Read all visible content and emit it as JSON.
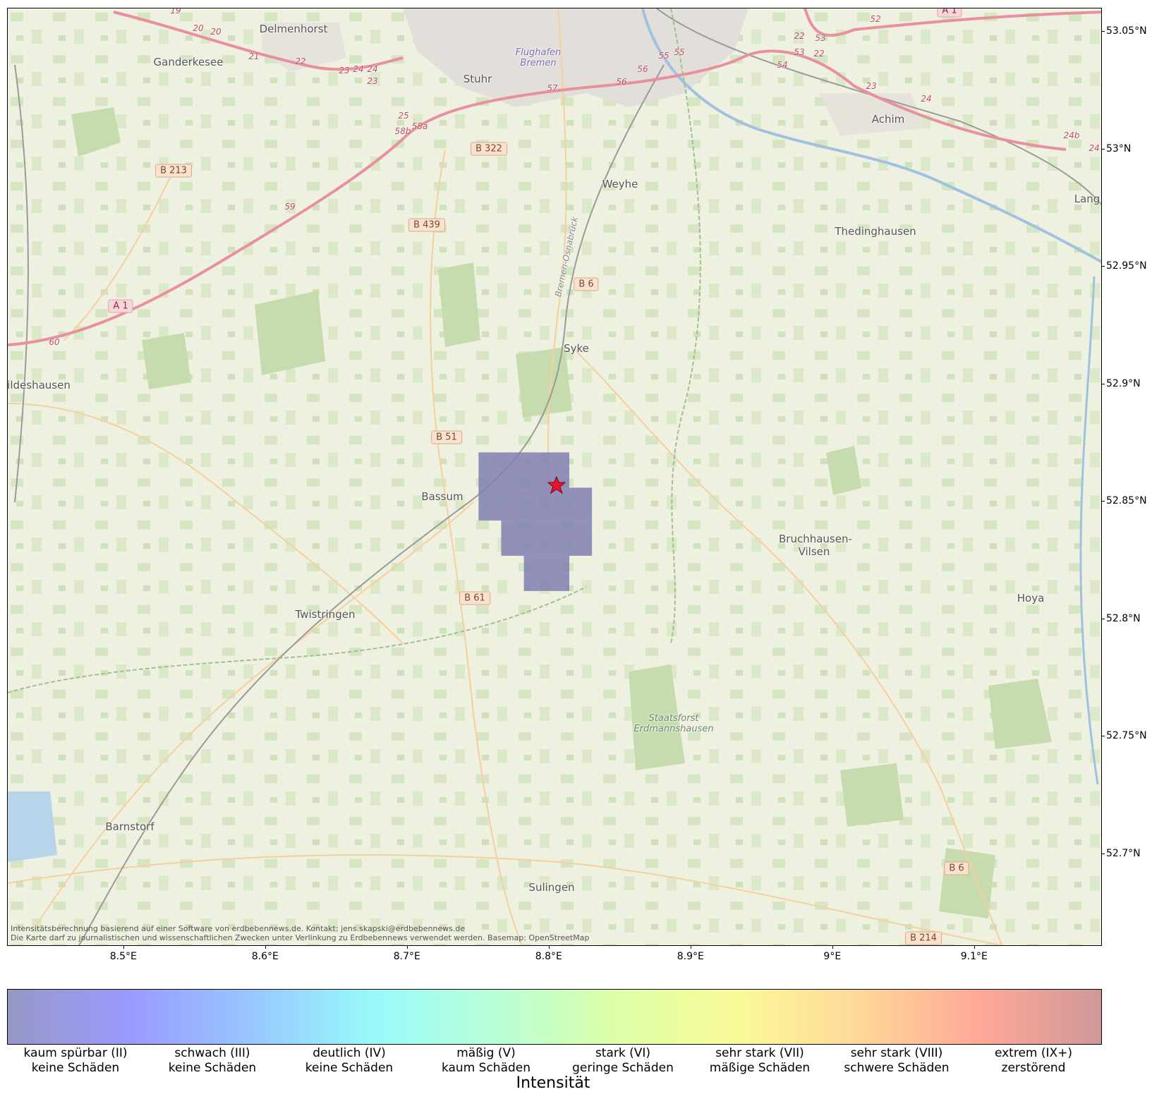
{
  "map": {
    "places": [
      {
        "name": "Delmenhorst",
        "style": "town"
      },
      {
        "name": "Ganderkesee",
        "style": "town"
      },
      {
        "name": "Stuhr",
        "style": "town"
      },
      {
        "name": "Flughafen Bremen",
        "style": "airport"
      },
      {
        "name": "Achim",
        "style": "town"
      },
      {
        "name": "Weyhe",
        "style": "town"
      },
      {
        "name": "Thedinghausen",
        "style": "town"
      },
      {
        "name": "Syke",
        "style": "town"
      },
      {
        "name": "ildeshausen",
        "style": "town"
      },
      {
        "name": "Bassum",
        "style": "town"
      },
      {
        "name": "Bruchhausen-Vilsen",
        "style": "town"
      },
      {
        "name": "Hoya",
        "style": "town"
      },
      {
        "name": "Twistringen",
        "style": "town"
      },
      {
        "name": "Staatsforst Erdmannshausen",
        "style": "forest"
      },
      {
        "name": "Barnstorf",
        "style": "town"
      },
      {
        "name": "Sulingen",
        "style": "town"
      },
      {
        "name": "Lang",
        "style": "town"
      }
    ],
    "road_shields": [
      {
        "label": "B 322",
        "type": "primary"
      },
      {
        "label": "B 213",
        "type": "primary"
      },
      {
        "label": "B 439",
        "type": "primary"
      },
      {
        "label": "B 6",
        "type": "primary"
      },
      {
        "label": "A 1",
        "type": "motorway"
      },
      {
        "label": "B 51",
        "type": "primary"
      },
      {
        "label": "B 61",
        "type": "primary"
      },
      {
        "label": "B 6",
        "type": "primary"
      },
      {
        "label": "B 214",
        "type": "primary"
      },
      {
        "label": "A 1",
        "type": "motorway"
      }
    ],
    "exit_numbers": [
      "19",
      "20",
      "20",
      "21",
      "22",
      "23",
      "24",
      "24",
      "23",
      "25",
      "58b",
      "58a",
      "57",
      "56",
      "56",
      "55",
      "55",
      "54",
      "53",
      "53",
      "52",
      "22",
      "22",
      "23",
      "24",
      "24b",
      "24",
      "59",
      "60"
    ],
    "road_names": [
      "Bremen-Osnabrück"
    ],
    "epicenter": {
      "lon": 8.805,
      "lat": 52.857,
      "symbol": "red-star"
    },
    "intensity_cells": [
      {
        "lon_min": 8.75,
        "lon_max": 8.814,
        "lat_min": 52.842,
        "lat_max": 52.871,
        "intensity": "II"
      },
      {
        "lon_min": 8.814,
        "lon_max": 8.83,
        "lat_min": 52.842,
        "lat_max": 52.856,
        "intensity": "II"
      },
      {
        "lon_min": 8.766,
        "lon_max": 8.83,
        "lat_min": 52.827,
        "lat_max": 52.842,
        "intensity": "II"
      },
      {
        "lon_min": 8.782,
        "lon_max": 8.814,
        "lat_min": 52.812,
        "lat_max": 52.827,
        "intensity": "II"
      }
    ],
    "attribution": [
      "Intensitätsberechnung basierend auf einer Software von erdbebennews.de. Kontakt: jens.skapski@erdbebennews.de",
      "Die Karte darf zu journalistischen und wissenschaftlichen Zwecken unter Verlinkung zu Erdbebennews verwendet werden. Basemap: OpenStreetMap"
    ]
  },
  "axes": {
    "lon_ticks": [
      {
        "value": 8.5,
        "label": "8.5°E"
      },
      {
        "value": 8.6,
        "label": "8.6°E"
      },
      {
        "value": 8.7,
        "label": "8.7°E"
      },
      {
        "value": 8.8,
        "label": "8.8°E"
      },
      {
        "value": 8.9,
        "label": "8.9°E"
      },
      {
        "value": 9.0,
        "label": "9°E"
      },
      {
        "value": 9.1,
        "label": "9.1°E"
      }
    ],
    "lat_ticks": [
      {
        "value": 53.05,
        "label": "53.05°N"
      },
      {
        "value": 53.0,
        "label": "53°N"
      },
      {
        "value": 52.95,
        "label": "52.95°N"
      },
      {
        "value": 52.9,
        "label": "52.9°N"
      },
      {
        "value": 52.85,
        "label": "52.85°N"
      },
      {
        "value": 52.8,
        "label": "52.8°N"
      },
      {
        "value": 52.75,
        "label": "52.75°N"
      },
      {
        "value": 52.7,
        "label": "52.7°N"
      }
    ],
    "lon_range": [
      8.418,
      9.19
    ],
    "lat_range": [
      52.66,
      53.06
    ]
  },
  "colorbar": {
    "title": "Intensität",
    "colors": [
      "#9898c6",
      "#9a9aff",
      "#98c6ff",
      "#98fafa",
      "#b8ffd8",
      "#dcffa8",
      "#fafa98",
      "#ffd898",
      "#ffa898",
      "#d09898"
    ],
    "levels": [
      {
        "line1": "kaum spürbar (II)",
        "line2": "keine Schäden"
      },
      {
        "line1": "schwach (III)",
        "line2": "keine Schäden"
      },
      {
        "line1": "deutlich (IV)",
        "line2": "keine Schäden"
      },
      {
        "line1": "mäßig (V)",
        "line2": "kaum Schäden"
      },
      {
        "line1": "stark (VI)",
        "line2": "geringe Schäden"
      },
      {
        "line1": "sehr stark (VII)",
        "line2": "mäßige Schäden"
      },
      {
        "line1": "sehr stark (VIII)",
        "line2": "schwere Schäden"
      },
      {
        "line1": "extrem (IX+)",
        "line2": "zerstörend"
      }
    ],
    "cell_color": "#7f7fb2"
  }
}
